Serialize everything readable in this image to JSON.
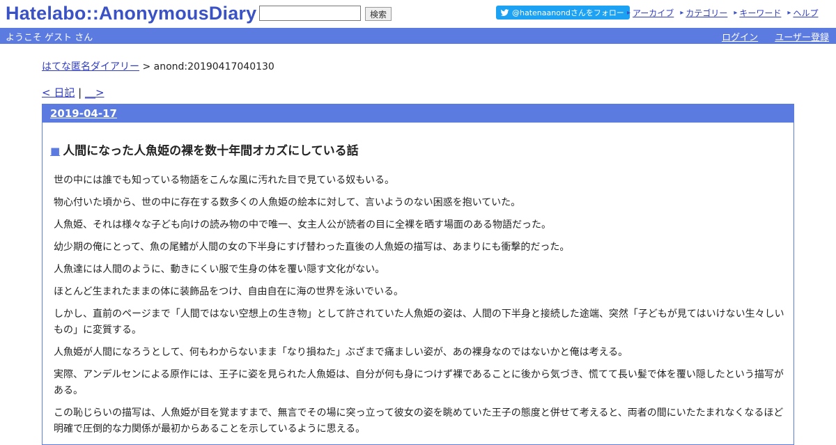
{
  "header": {
    "logo": "Hatelabo::AnonymousDiary",
    "search_button": "検索",
    "follow_label": "@hatenaanondさんをフォロー",
    "links": [
      "アーカイブ",
      "カテゴリー",
      "キーワード",
      "ヘルプ"
    ]
  },
  "userbar": {
    "welcome": "ようこそ ゲスト さん",
    "login": "ログイン",
    "register": "ユーザー登録"
  },
  "breadcrumb": {
    "root": "はてな匿名ダイアリー",
    "separator": " > ",
    "current": "anond:20190417040130"
  },
  "pager": {
    "prev": "< 日記",
    "divider": " | ",
    "next": "__>"
  },
  "entry": {
    "date": "2019-04-17",
    "title": "人間になった人魚姫の裸を数十年間オカズにしている話",
    "paragraphs": [
      "世の中には誰でも知っている物語をこんな風に汚れた目で見ている奴もいる。",
      "物心付いた頃から、世の中に存在する数多くの人魚姫の絵本に対して、言いようのない困惑を抱いていた。",
      "人魚姫、それは様々な子ども向けの読み物の中で唯一、女主人公が読者の目に全裸を晒す場面のある物語だった。",
      "幼少期の俺にとって、魚の尾鰭が人間の女の下半身にすげ替わった直後の人魚姫の描写は、あまりにも衝撃的だった。",
      "人魚達には人間のように、動きにくい服で生身の体を覆い隠す文化がない。",
      "ほとんど生まれたままの体に装飾品をつけ、自由自在に海の世界を泳いでいる。",
      "しかし、直前のページまで「人間ではない空想上の生き物」として許されていた人魚姫の姿は、人間の下半身と接続した途端、突然「子どもが見てはいけない生々しいもの」に変質する。",
      "人魚姫が人間になろうとして、何もわからないまま「なり損ねた」ぶざまで痛ましい姿が、あの裸身なのではないかと俺は考える。",
      "実際、アンデルセンによる原作には、王子に姿を見られた人魚姫は、自分が何も身につけず裸であることに後から気づき、慌てて長い髪で体を覆い隠したという描写がある。",
      "この恥じらいの描写は、人魚姫が目を覚ますまで、無言でその場に突っ立って彼女の姿を眺めていた王子の態度と併せて考えると、両者の間にいたたまれなくなるほど明確で圧倒的な力関係が最初からあることを示しているように思える。"
    ]
  }
}
